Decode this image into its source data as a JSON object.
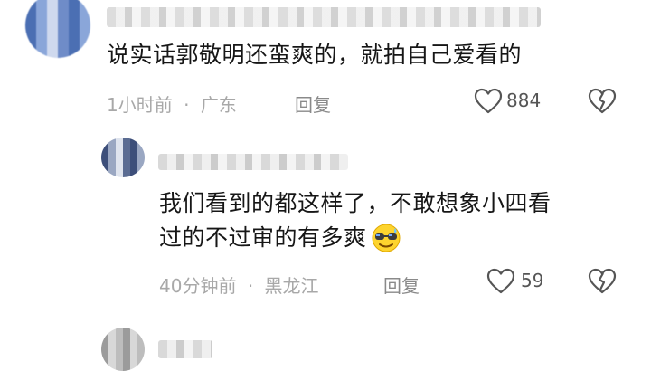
{
  "comment1": {
    "text": "说实话郭敬明还蛮爽的，就拍自己爱看的",
    "time": "1小时前",
    "location": "广东",
    "reply_label": "回复",
    "likes": "884"
  },
  "comment2": {
    "text_line1": "我们看到的都这样了，不敢想象小四看",
    "text_line2": "过的不过审的有多爽",
    "time": "40分钟前",
    "location": "黑龙江",
    "reply_label": "回复",
    "likes": "59"
  },
  "separator": "·",
  "icons": {
    "like": "heart-outline-icon",
    "dislike": "broken-heart-icon",
    "emoji": "cool-sunglasses-emoji-icon"
  },
  "colors": {
    "text": "#161616",
    "meta": "#a8a8a8",
    "count": "#555555"
  }
}
